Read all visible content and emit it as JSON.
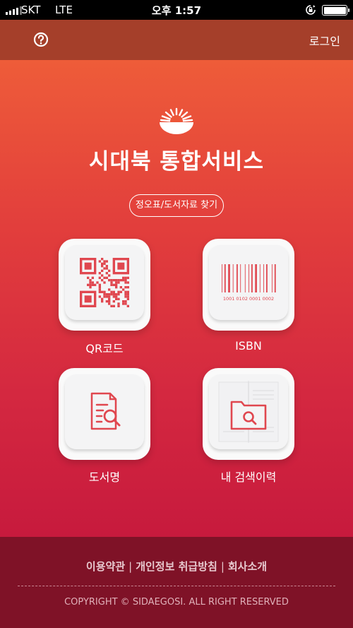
{
  "status_bar": {
    "carrier": "SKT",
    "network": "LTE",
    "time": "오후 1:57"
  },
  "header": {
    "help_icon": "question-circle-icon",
    "login_label": "로그인"
  },
  "main": {
    "title": "시대북 통합서비스",
    "find_button": "정오표/도서자료 찾기",
    "tiles": [
      {
        "label": "QR코드",
        "icon": "qr-code-icon"
      },
      {
        "label": "ISBN",
        "icon": "barcode-icon",
        "barcode_digits": "1001  0102  0001  0002"
      },
      {
        "label": "도서명",
        "icon": "document-search-icon"
      },
      {
        "label": "내 검색이력",
        "icon": "folder-search-icon"
      }
    ]
  },
  "footer": {
    "links": [
      "이용약관",
      "개인정보 취급방침",
      "회사소개"
    ],
    "separator": "|",
    "copyright": "COPYRIGHT © SIDAEGOSI. ALL RIGHT RESERVED"
  },
  "colors": {
    "header_bg": "#a53f2a",
    "gradient_top": "#ee5c39",
    "gradient_bottom": "#c71a3d",
    "footer_bg": "#7f1227",
    "icon_red": "#e0474f"
  }
}
